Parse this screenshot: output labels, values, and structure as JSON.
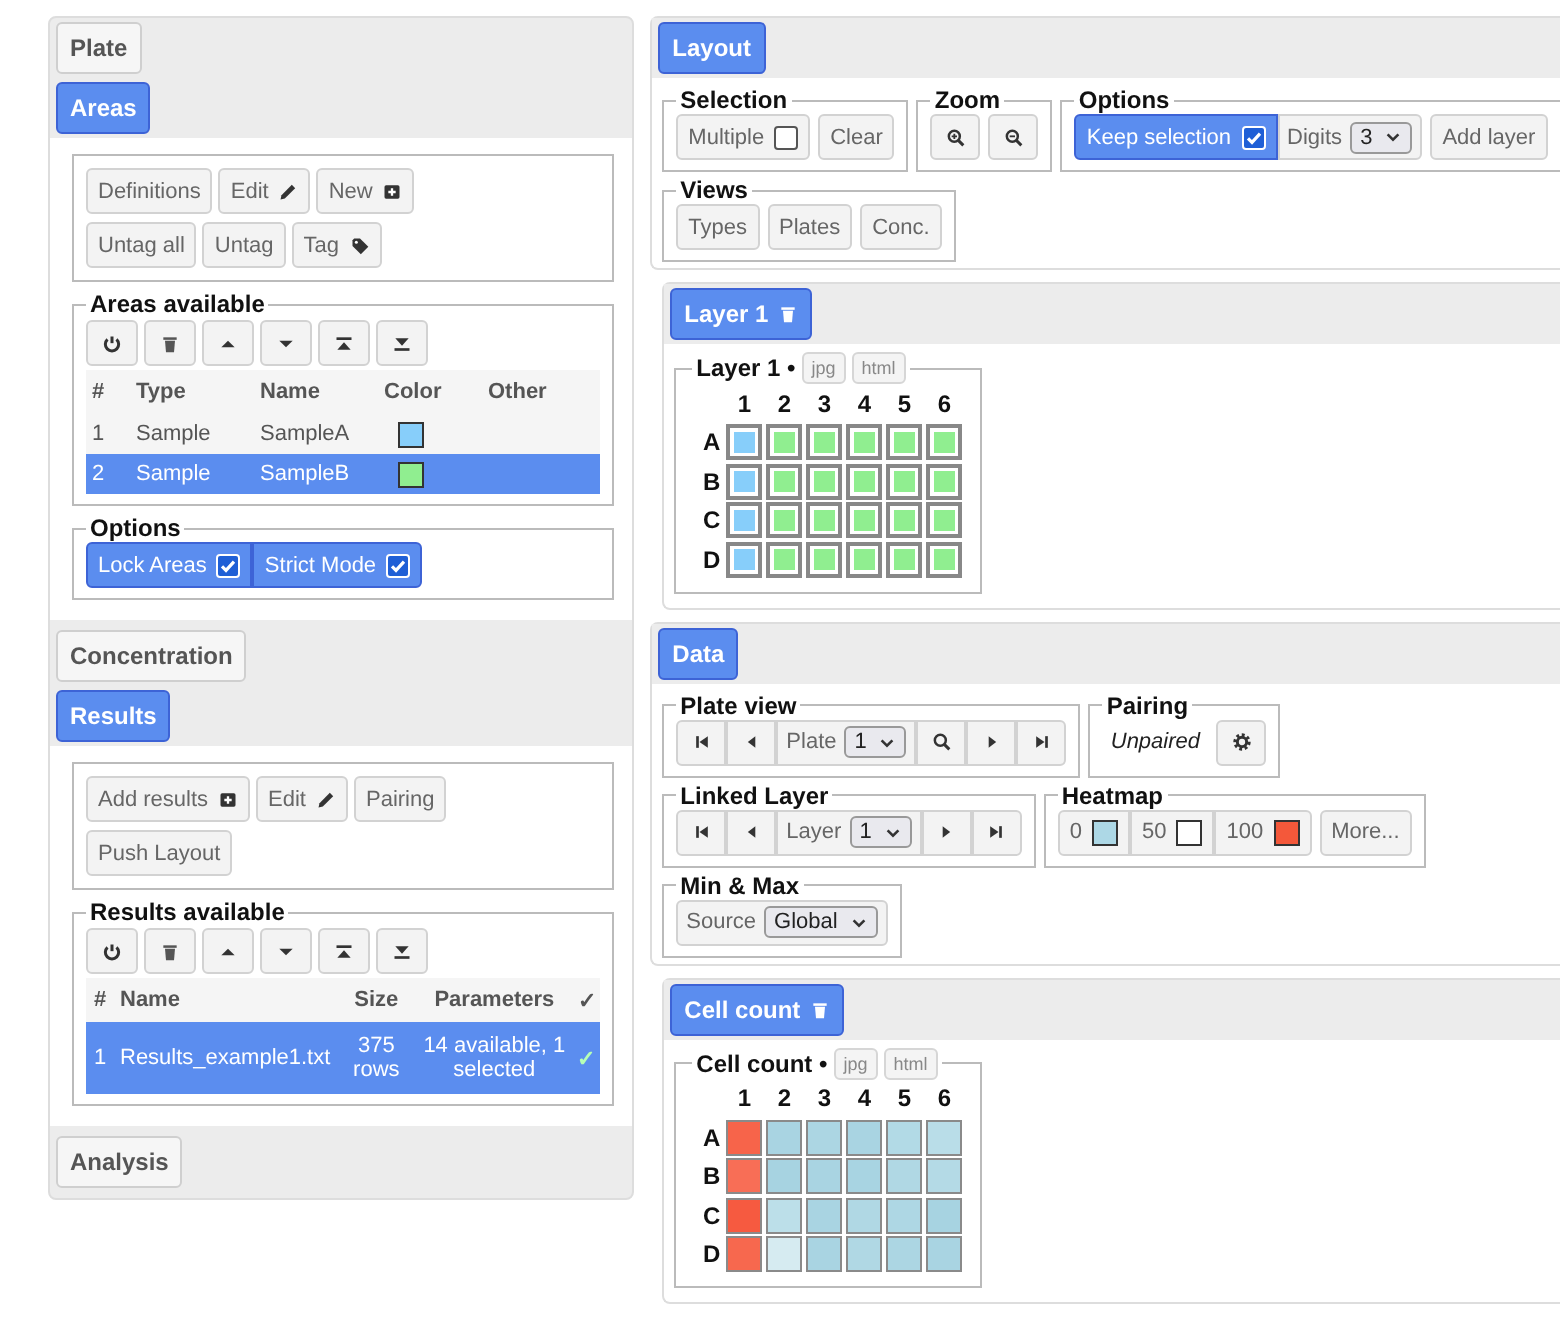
{
  "left_sections": [
    {
      "label": "Plate",
      "selected": false
    },
    {
      "label": "Areas",
      "selected": true,
      "content": {
        "button_rows": [
          [
            {
              "label": "Definitions",
              "kind": "plain"
            },
            {
              "label": "Edit",
              "kind": "edit"
            },
            {
              "label": "New",
              "kind": "new"
            }
          ],
          [
            {
              "label": "Untag all",
              "kind": "plain"
            },
            {
              "label": "Untag",
              "kind": "plain"
            },
            {
              "label": "Tag",
              "kind": "tag"
            }
          ]
        ],
        "table": {
          "legend": "Areas available",
          "kind": "areas",
          "columns": [
            "#",
            "Type",
            "Name",
            "Color",
            "Other"
          ],
          "rows": [
            {
              "cells": [
                "1",
                "Sample",
                "SampleA"
              ],
              "color": "#87cefa",
              "selected": false
            },
            {
              "cells": [
                "2",
                "Sample",
                "SampleB"
              ],
              "color": "#90ee90",
              "selected": true
            }
          ]
        },
        "options": {
          "legend": "Options",
          "toggles": [
            {
              "label": "Lock Areas",
              "checked": true
            },
            {
              "label": "Strict Mode",
              "checked": true
            }
          ]
        }
      }
    },
    {
      "label": "Concentration",
      "selected": false
    },
    {
      "label": "Results",
      "selected": true,
      "content": {
        "button_rows": [
          [
            {
              "label": "Add results",
              "kind": "new"
            },
            {
              "label": "Edit",
              "kind": "edit"
            },
            {
              "label": "Pairing",
              "kind": "plain"
            }
          ],
          [
            {
              "label": "Push Layout",
              "kind": "plain"
            }
          ]
        ],
        "table": {
          "legend": "Results available",
          "kind": "results",
          "columns": [
            "#",
            "Name",
            "Size",
            "Parameters",
            "✓"
          ],
          "rows": [
            {
              "cells": [
                "1",
                "Results_example1.txt",
                "375 rows",
                "14 available, 1 selected",
                "✓"
              ],
              "selected": true
            }
          ]
        }
      }
    },
    {
      "label": "Analysis",
      "selected": false
    }
  ],
  "right_sections": [
    {
      "label": "Layout",
      "selected": true,
      "kind": "controls",
      "groups": [
        {
          "legend": "Selection",
          "segments": [
            [
              {
                "kind": "toggle",
                "label": "Multiple",
                "checked": false
              }
            ],
            [
              {
                "kind": "button",
                "label": "Clear"
              }
            ]
          ]
        },
        {
          "legend": "Zoom",
          "segments": [
            [
              {
                "kind": "zoom-in"
              }
            ],
            [
              {
                "kind": "zoom-out"
              }
            ]
          ]
        },
        {
          "legend": "Options",
          "segments": [
            [
              {
                "kind": "toggle",
                "label": "Keep selection",
                "checked": true
              },
              {
                "kind": "select",
                "label": "Digits",
                "value": "3"
              }
            ],
            [
              {
                "kind": "button",
                "label": "Add layer"
              }
            ]
          ]
        },
        {
          "legend": "Views",
          "segments": [
            [
              {
                "kind": "button",
                "label": "Types"
              }
            ],
            [
              {
                "kind": "button",
                "label": "Plates"
              }
            ],
            [
              {
                "kind": "button",
                "label": "Conc."
              }
            ]
          ]
        }
      ]
    },
    {
      "label": "Layer 1",
      "selected": true,
      "kind": "plate",
      "plate": {
        "kind": "layer",
        "legend": "Layer 1 •",
        "exports": [
          "jpg",
          "html"
        ],
        "columns": [
          "1",
          "2",
          "3",
          "4",
          "5",
          "6"
        ],
        "rows": [
          {
            "label": "A",
            "wells": [
              {
                "color": "#87cefa"
              },
              {
                "color": "#90ee90"
              },
              {
                "color": "#90ee90"
              },
              {
                "color": "#90ee90"
              },
              {
                "color": "#90ee90"
              },
              {
                "color": "#90ee90"
              }
            ]
          },
          {
            "label": "B",
            "wells": [
              {
                "color": "#87cefa"
              },
              {
                "color": "#90ee90"
              },
              {
                "color": "#90ee90"
              },
              {
                "color": "#90ee90"
              },
              {
                "color": "#90ee90"
              },
              {
                "color": "#90ee90"
              }
            ]
          },
          {
            "label": "C",
            "wells": [
              {
                "color": "#87cefa"
              },
              {
                "color": "#90ee90"
              },
              {
                "color": "#90ee90"
              },
              {
                "color": "#90ee90"
              },
              {
                "color": "#90ee90"
              },
              {
                "color": "#90ee90"
              }
            ]
          },
          {
            "label": "D",
            "wells": [
              {
                "color": "#87cefa"
              },
              {
                "color": "#90ee90"
              },
              {
                "color": "#90ee90"
              },
              {
                "color": "#90ee90"
              },
              {
                "color": "#90ee90"
              },
              {
                "color": "#90ee90"
              }
            ]
          }
        ]
      }
    },
    {
      "label": "Data",
      "selected": true,
      "kind": "controls",
      "groups": [
        {
          "legend": "Plate view",
          "segments": [
            [
              {
                "kind": "first"
              },
              {
                "kind": "prev"
              },
              {
                "kind": "select",
                "label": "Plate",
                "value": "1"
              },
              {
                "kind": "search"
              },
              {
                "kind": "next"
              },
              {
                "kind": "last"
              }
            ]
          ]
        },
        {
          "legend": "Pairing",
          "segments": [
            [
              {
                "kind": "note",
                "label": "Unpaired"
              }
            ],
            [
              {
                "kind": "gear"
              }
            ]
          ]
        },
        {
          "legend": "Linked Layer",
          "segments": [
            [
              {
                "kind": "first"
              },
              {
                "kind": "prev"
              },
              {
                "kind": "select",
                "label": "Layer",
                "value": "1"
              },
              {
                "kind": "next"
              },
              {
                "kind": "last"
              }
            ]
          ]
        },
        {
          "legend": "Heatmap",
          "segments": [
            [
              {
                "kind": "swatch",
                "label": "0",
                "color": "#add8e6"
              },
              {
                "kind": "swatch",
                "label": "50",
                "color": "#ffffff"
              },
              {
                "kind": "swatch",
                "label": "100",
                "color": "#f4583a"
              }
            ],
            [
              {
                "kind": "button",
                "label": "More..."
              }
            ]
          ]
        },
        {
          "legend": "Min & Max",
          "segments": [
            [
              {
                "kind": "select",
                "label": "Source",
                "value": "Global"
              }
            ]
          ]
        }
      ]
    },
    {
      "label": "Cell count",
      "selected": true,
      "kind": "plate",
      "plate": {
        "kind": "heatmap",
        "legend": "Cell count •",
        "exports": [
          "jpg",
          "html"
        ],
        "columns": [
          "1",
          "2",
          "3",
          "4",
          "5",
          "6"
        ],
        "rows": [
          {
            "label": "A",
            "wells": [
              {
                "color": "#f7644a"
              },
              {
                "color": "#a9d4e2"
              },
              {
                "color": "#acd6e3"
              },
              {
                "color": "#a9d4e2"
              },
              {
                "color": "#b2dae6"
              },
              {
                "color": "#b9dde8"
              }
            ]
          },
          {
            "label": "B",
            "wells": [
              {
                "color": "#f86e56"
              },
              {
                "color": "#a7d3e1"
              },
              {
                "color": "#a9d4e2"
              },
              {
                "color": "#a8d4e2"
              },
              {
                "color": "#b0d8e4"
              },
              {
                "color": "#b4dae6"
              }
            ]
          },
          {
            "label": "C",
            "wells": [
              {
                "color": "#f65a40"
              },
              {
                "color": "#bcdfe9"
              },
              {
                "color": "#a9d4e2"
              },
              {
                "color": "#b0d8e4"
              },
              {
                "color": "#aed7e4"
              },
              {
                "color": "#a7d3e1"
              }
            ]
          },
          {
            "label": "D",
            "wells": [
              {
                "color": "#f7684e"
              },
              {
                "color": "#d6ebf1"
              },
              {
                "color": "#a9d4e2"
              },
              {
                "color": "#b0d8e4"
              },
              {
                "color": "#acd6e3"
              },
              {
                "color": "#a9d4e2"
              }
            ]
          }
        ]
      }
    }
  ]
}
